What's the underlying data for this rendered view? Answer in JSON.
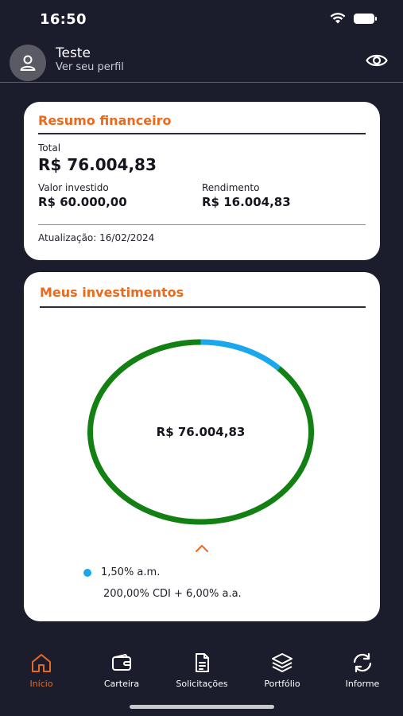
{
  "status": {
    "time": "16:50",
    "icons": [
      "wifi-icon",
      "battery-icon"
    ]
  },
  "profile": {
    "name": "Teste",
    "link": "Ver seu perfil",
    "icons": [
      "user-icon",
      "eye-icon"
    ]
  },
  "summary": {
    "title": "Resumo financeiro",
    "total_label": "Total",
    "total_value": "R$ 76.004,83",
    "invested_label": "Valor investido",
    "invested_value": "R$ 60.000,00",
    "yield_label": "Rendimento",
    "yield_value": "R$ 16.004,83",
    "updated": "Atualização: 16/02/2024"
  },
  "investments": {
    "title": "Meus investimentos",
    "center_value": "R$ 76.004,83",
    "legend": {
      "rate": "1,50% a.m.",
      "description": "200,00% CDI + 6,00% a.a."
    },
    "chart": {
      "type": "donut",
      "segments": [
        {
          "color": "#1aa7ec",
          "fraction": 0.125
        },
        {
          "color": "#128012",
          "fraction": 0.875
        }
      ]
    }
  },
  "nav": {
    "items": [
      {
        "label": "Início",
        "icon": "home-icon",
        "active": true
      },
      {
        "label": "Carteira",
        "icon": "wallet-icon",
        "active": false
      },
      {
        "label": "Solicitações",
        "icon": "document-icon",
        "active": false
      },
      {
        "label": "Portfólio",
        "icon": "layers-icon",
        "active": false
      },
      {
        "label": "Informe",
        "icon": "refresh-icon",
        "active": false
      }
    ]
  },
  "colors": {
    "background": "#1b1d2d",
    "accent": "#ea6a1d",
    "card": "#ffffff",
    "donut_green": "#128012",
    "donut_blue": "#1aa7ec"
  }
}
